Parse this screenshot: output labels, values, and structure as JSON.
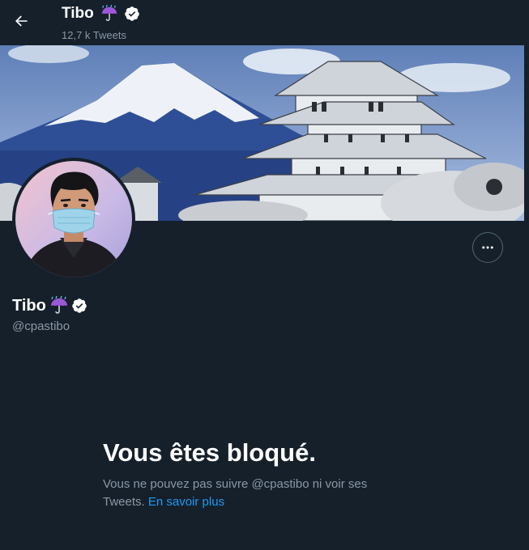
{
  "header": {
    "back_icon": "arrow-left-icon",
    "name": "Tibo",
    "name_emoji": "umbrella-with-rain-icon",
    "verified_icon": "verified-badge-icon",
    "tweet_count": "12,7 k Tweets"
  },
  "banner": {
    "description": ""
  },
  "profile": {
    "name": "Tibo",
    "handle": "@cpastibo",
    "more_icon": "more-horizontal-icon"
  },
  "blocked": {
    "title": "Vous êtes bloqué.",
    "text": "Vous ne pouvez pas suivre @cpastibo ni voir ses Tweets.",
    "link": "En savoir plus"
  },
  "colors": {
    "background": "#15202b",
    "accent": "#1d9bf0",
    "secondary_text": "#8b98a5"
  }
}
